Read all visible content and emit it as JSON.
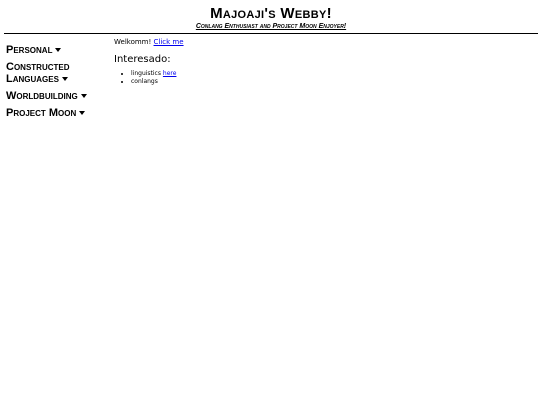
{
  "header": {
    "title": "Majoaji's Webby!",
    "subtitle": "Conlang Enthusiast and Project Moon Enjoyer!"
  },
  "sidebar": {
    "items": [
      {
        "label": "Personal"
      },
      {
        "label": "Constructed Languages"
      },
      {
        "label": "Worldbuilding"
      },
      {
        "label": "Project Moon"
      }
    ]
  },
  "main": {
    "welcome_text": "Welkomm!",
    "welcome_link": "Click me",
    "interests_heading": "Interesado:",
    "interests": [
      {
        "text": "linguistics",
        "link": "here"
      },
      {
        "text": "conlangs"
      }
    ]
  }
}
